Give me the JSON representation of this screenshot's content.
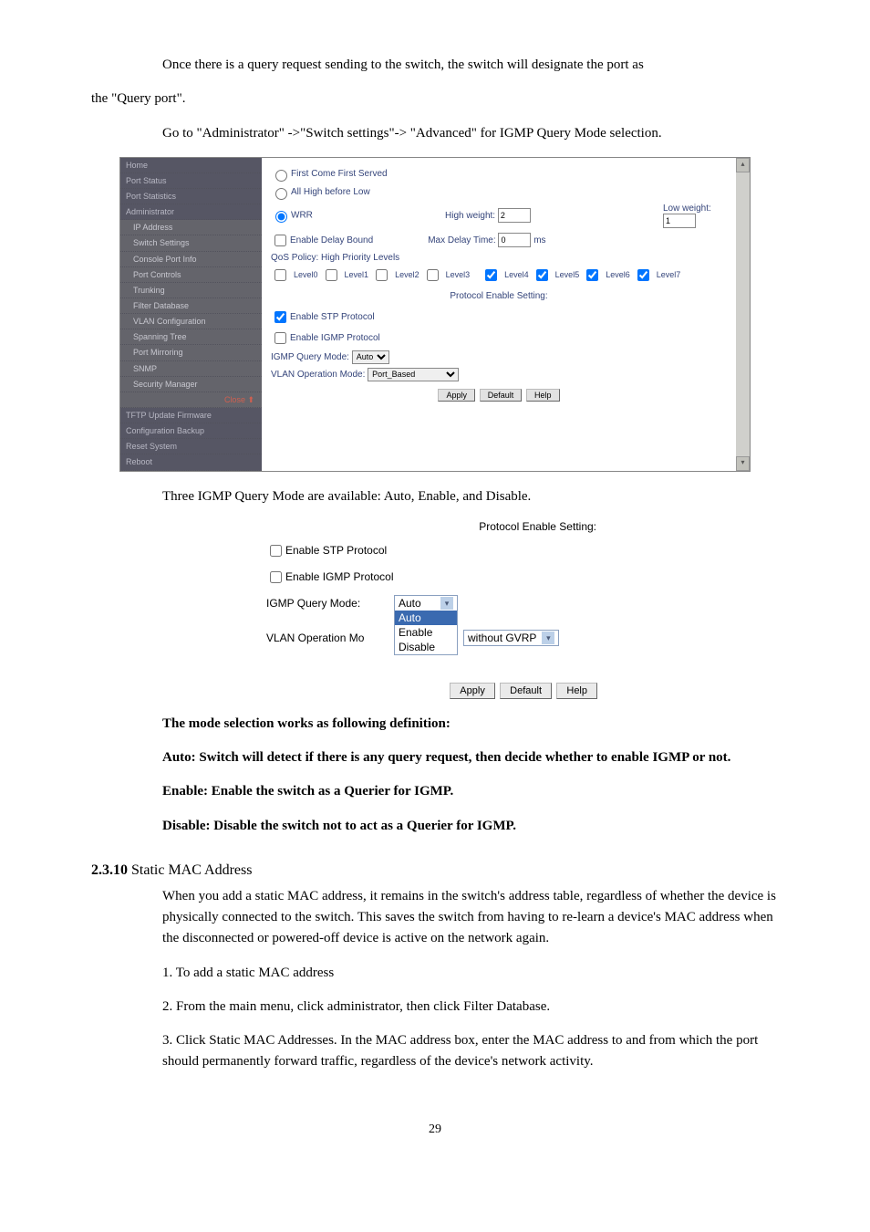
{
  "p1": {
    "line1a": "Once there is a query request sending to the switch, the switch will designate the port as ",
    "line1b": "the \"Query port\"."
  },
  "intro2": "Go to \"Administrator\" ->\"Switch settings\"->  \"Advanced\" for IGMP Query Mode selection.",
  "shot1": {
    "side": {
      "home": "Home",
      "portStatus": "Port Status",
      "portStatistics": "Port Statistics",
      "admin": "Administrator",
      "ip": "IP Address",
      "switchSettings": "Switch Settings",
      "consolePort": "Console Port Info",
      "portControls": "Port Controls",
      "trunking": "Trunking",
      "filterDb": "Filter Database",
      "vlanCfg": "VLAN Configuration",
      "spanning": "Spanning Tree",
      "portMirror": "Port Mirroring",
      "snmp": "SNMP",
      "secmgr": "Security Manager",
      "close": "Close ⬆",
      "tftp": "TFTP Update Firmware",
      "cfgBackup": "Configuration Backup",
      "resetSys": "Reset System",
      "reboot": "Reboot"
    },
    "main": {
      "fcfs": "First Come First Served",
      "ahbl": "All High before Low",
      "wrr": "WRR",
      "highWeight": "High weight:",
      "highWeightVal": "2",
      "lowWeight": "Low weight:",
      "lowWeightVal": "1",
      "edb": "Enable Delay Bound",
      "mdt": "Max Delay Time:",
      "mdtVal": "0",
      "ms": "ms",
      "qos": "QoS Policy: High Priority Levels",
      "lv0": "Level0",
      "lv1": "Level1",
      "lv2": "Level2",
      "lv3": "Level3",
      "lv4": "Level4",
      "lv5": "Level5",
      "lv6": "Level6",
      "lv7": "Level7",
      "pes": "Protocol Enable Setting:",
      "estp": "Enable STP Protocol",
      "eigmp": "Enable IGMP Protocol",
      "iqm": "IGMP Query Mode:",
      "iqmVal": "Auto",
      "vom": "VLAN Operation Mode:",
      "vomVal": "Port_Based",
      "apply": "Apply",
      "default": "Default",
      "help": "Help"
    }
  },
  "after1": {
    "t": "Three IGMP Query Mode are available: Auto, Enable, and Disable."
  },
  "shot2": {
    "pes": "Protocol Enable Setting:",
    "estp": "Enable STP Protocol",
    "eigmp": "Enable IGMP Protocol",
    "iqm": "IGMP Query Mode:",
    "opts": {
      "auto": "Auto",
      "auto2": "Auto",
      "enable": "Enable",
      "disable": "Disable"
    },
    "vom": "VLAN Operation Mo",
    "vomVal": "without GVRP",
    "apply": "Apply",
    "default": "Default",
    "help": "Help"
  },
  "explain": {
    "h": "The mode selection works as following definition:",
    "a": "Auto: Switch will detect if there is any query request, then decide whether to enable IGMP or not.",
    "b": "Enable: Enable the switch as a Querier for IGMP.",
    "c": "Disable: Disable the switch not to act as a Querier for IGMP."
  },
  "sec": {
    "num": "2.3.10",
    "title": " Static MAC Address"
  },
  "static": {
    "p1": "When you add a static MAC address, it remains in the switch's address table, regardless of whether the device is physically connected to the switch. This saves the switch from having to re-learn a device's MAC address when the disconnected or powered-off device is active on the network again.",
    "p2": "1. To add a static MAC address",
    "p3": "2. From the main menu, click administrator, then click Filter Database.",
    "p4": "3.  Click  Static MAC Addresses. In the MAC address box, enter the MAC address to and from which the port should permanently forward traffic, regardless of the device's network activity."
  },
  "page": "29"
}
